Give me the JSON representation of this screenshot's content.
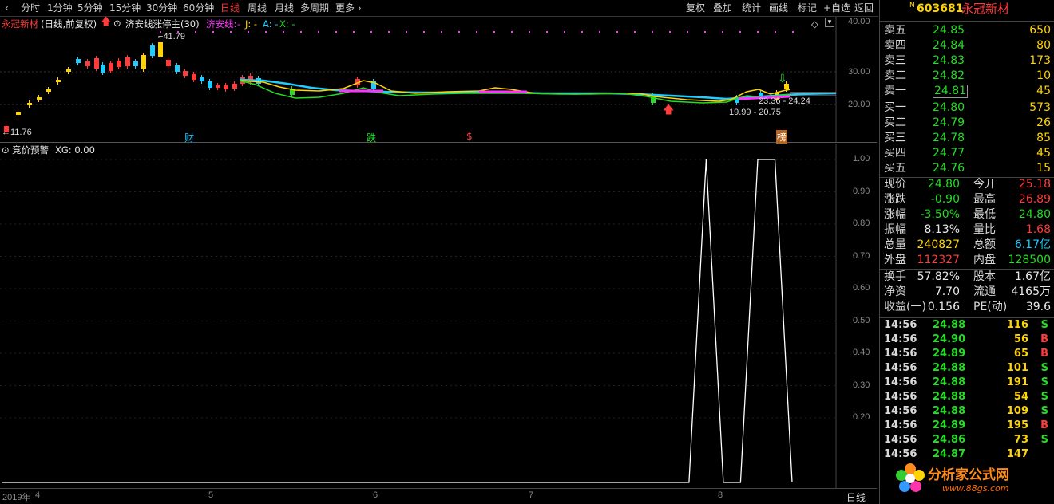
{
  "toolbar": {
    "periods": [
      "分时",
      "1分钟",
      "5分钟",
      "15分钟",
      "30分钟",
      "60分钟",
      "日线",
      "周线",
      "月线",
      "多周期",
      "更多"
    ],
    "active_period": "日线",
    "right_items": [
      "复权",
      "叠加",
      "统计",
      "画线",
      "标记",
      "+自选",
      "返回"
    ]
  },
  "stock_info": {
    "name": "永冠新材",
    "mode": "(日线,前复权)",
    "indicator_name": "济安线涨停主(30)",
    "indicator_line": "济安线:",
    "indicator_vals": [
      "-",
      "J: -",
      "A: -",
      "X: -"
    ]
  },
  "price_axis": {
    "ticks": [
      "40.00",
      "30.00",
      "20.00"
    ]
  },
  "annotations": {
    "high": "41.79",
    "low": "11.76",
    "range1": "23.36 - 24.24",
    "range2": "19.99 - 20.75",
    "markers": [
      "财",
      "跌",
      "$",
      "榜"
    ]
  },
  "sub_chart": {
    "title": "竞价预警",
    "value_label": "XG: 0.00",
    "ticks": [
      "1.00",
      "0.90",
      "0.80",
      "0.70",
      "0.60",
      "0.50",
      "0.40",
      "0.30",
      "0.20"
    ],
    "chart_data": {
      "type": "line",
      "series": [
        {
          "name": "XG",
          "values": [
            0,
            0,
            0,
            0,
            0,
            0,
            0,
            0,
            0,
            0,
            0,
            0,
            0,
            0,
            0,
            0,
            0,
            0,
            0,
            0,
            0,
            0,
            0,
            0,
            0,
            0,
            0,
            0,
            0,
            0,
            0,
            0,
            0,
            0,
            0,
            0,
            0,
            0,
            0,
            0,
            0,
            1,
            0,
            0,
            1,
            1,
            0
          ]
        }
      ],
      "ylim": [
        0,
        1.0
      ]
    }
  },
  "date_axis": {
    "labels": [
      "2019年",
      "4",
      "5",
      "6",
      "7",
      "8"
    ],
    "period_label": "日线"
  },
  "right_panel": {
    "code_badge": "N",
    "code": "603681",
    "name": "永冠新材",
    "sell": [
      {
        "label": "卖五",
        "price": "24.85",
        "vol": "650"
      },
      {
        "label": "卖四",
        "price": "24.84",
        "vol": "80"
      },
      {
        "label": "卖三",
        "price": "24.83",
        "vol": "173"
      },
      {
        "label": "卖二",
        "price": "24.82",
        "vol": "10"
      },
      {
        "label": "卖一",
        "price": "24.81",
        "vol": "45"
      }
    ],
    "buy": [
      {
        "label": "买一",
        "price": "24.80",
        "vol": "573"
      },
      {
        "label": "买二",
        "price": "24.79",
        "vol": "26"
      },
      {
        "label": "买三",
        "price": "24.78",
        "vol": "85"
      },
      {
        "label": "买四",
        "price": "24.77",
        "vol": "45"
      },
      {
        "label": "买五",
        "price": "24.76",
        "vol": "15"
      }
    ],
    "stats": [
      {
        "l1": "现价",
        "v1": "24.80",
        "l2": "今开",
        "v2": "25.18"
      },
      {
        "l1": "涨跌",
        "v1": "-0.90",
        "l2": "最高",
        "v2": "26.89"
      },
      {
        "l1": "涨幅",
        "v1": "-3.50%",
        "l2": "最低",
        "v2": "24.80"
      },
      {
        "l1": "振幅",
        "v1": "8.13%",
        "l2": "量比",
        "v2": "1.68"
      },
      {
        "l1": "总量",
        "v1": "240827",
        "l2": "总额",
        "v2": "6.17亿"
      },
      {
        "l1": "外盘",
        "v1": "112327",
        "l2": "内盘",
        "v2": "128500"
      }
    ],
    "fundamentals": [
      {
        "l1": "换手",
        "v1": "57.82%",
        "l2": "股本",
        "v2": "1.67亿"
      },
      {
        "l1": "净资",
        "v1": "7.70",
        "l2": "流通",
        "v2": "4165万"
      },
      {
        "l1": "收益(一)",
        "v1": "0.156",
        "l2": "PE(动)",
        "v2": "39.6"
      }
    ],
    "ticks": [
      {
        "time": "14:56",
        "price": "24.88",
        "vol": "116",
        "side": "S"
      },
      {
        "time": "14:56",
        "price": "24.90",
        "vol": "56",
        "side": "B"
      },
      {
        "time": "14:56",
        "price": "24.89",
        "vol": "65",
        "side": "B"
      },
      {
        "time": "14:56",
        "price": "24.88",
        "vol": "101",
        "side": "S"
      },
      {
        "time": "14:56",
        "price": "24.88",
        "vol": "191",
        "side": "S"
      },
      {
        "time": "14:56",
        "price": "24.88",
        "vol": "54",
        "side": "S"
      },
      {
        "time": "14:56",
        "price": "24.88",
        "vol": "109",
        "side": "S"
      },
      {
        "time": "14:56",
        "price": "24.89",
        "vol": "195",
        "side": "B"
      },
      {
        "time": "14:56",
        "price": "24.86",
        "vol": "73",
        "side": "S"
      },
      {
        "time": "14:56",
        "price": "24.87",
        "vol": "147",
        "side": ""
      }
    ]
  },
  "watermark": {
    "text": "分析家公式网",
    "url": "www.88gs.com"
  },
  "colors": {
    "up": "#ff3b3b",
    "down": "#22dd22",
    "cyan": "#22ccff",
    "yellow": "#ffd400",
    "magenta": "#ff33ff"
  }
}
